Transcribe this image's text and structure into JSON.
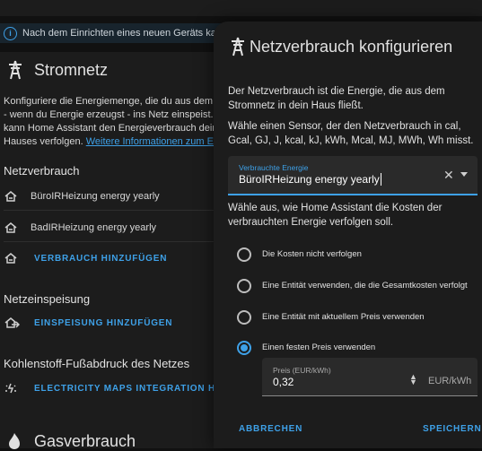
{
  "info": {
    "text": "Nach dem Einrichten eines neuen Geräts kann es"
  },
  "grid": {
    "title": "Stromnetz",
    "description_lines": [
      "Konfiguriere die Energiemenge, die du aus dem Netz",
      "- wenn du Energie erzeugst - ins Netz einspeist. Auf",
      "kann Home Assistant den Energieverbrauch deines",
      "Hauses verfolgen."
    ],
    "more_info_link": "Weitere Informationen zum Einsti",
    "consumption_header": "Netzverbrauch",
    "consumption_items": [
      "BüroIRHeizung energy yearly",
      "BadIRHeizung energy yearly"
    ],
    "add_consumption": "VERBRAUCH HINZUFÜGEN",
    "feed_in_header": "Netzeinspeisung",
    "add_feed_in": "EINSPEISUNG HINZUFÜGEN",
    "co2_header": "Kohlenstoff-Fußabdruck des Netzes",
    "co2_link": "ELECTRICITY MAPS INTEGRATION HINZUF",
    "gas_title": "Gasverbrauch"
  },
  "dialog": {
    "title": "Netzverbrauch konfigurieren",
    "para1": "Der Netzverbrauch ist die Energie, die aus dem Stromnetz in dein Haus fließt.",
    "para2": "Wähle einen Sensor, der den Netzverbrauch in cal, Gcal, GJ, J, kcal, kJ, kWh, Mcal, MJ, MWh, Wh misst.",
    "sensor_label": "Verbrauchte Energie",
    "sensor_value": "BüroIRHeizung energy yearly",
    "para3": "Wähle aus, wie Home Assistant die Kosten der verbrauchten Energie verfolgen soll.",
    "options": [
      {
        "label": "Die Kosten nicht verfolgen",
        "selected": false
      },
      {
        "label": "Eine Entität verwenden, die die Gesamtkosten verfolgt",
        "selected": false
      },
      {
        "label": "Eine Entität mit aktuellem Preis verwenden",
        "selected": false
      },
      {
        "label": "Einen festen Preis verwenden",
        "selected": true
      }
    ],
    "price_label": "Preis (EUR/kWh)",
    "price_value": "0,32",
    "price_unit": "EUR/kWh",
    "cancel": "ABBRECHEN",
    "save": "SPEICHERN"
  },
  "colors": {
    "accent": "#3ea1e8",
    "surface": "#1c1c1c",
    "background": "#111111"
  }
}
